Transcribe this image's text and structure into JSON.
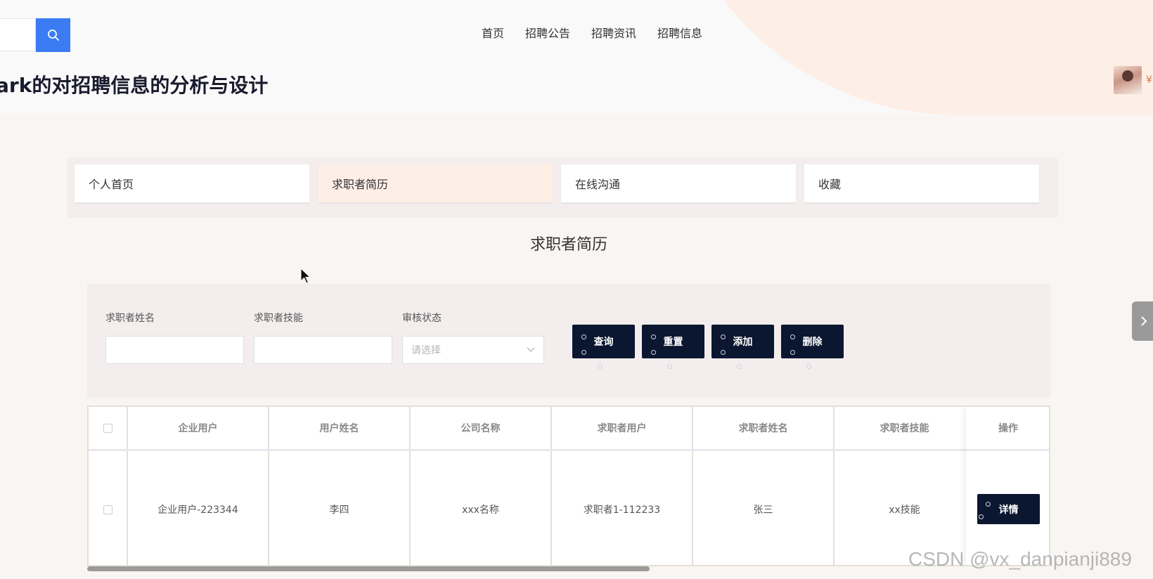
{
  "header": {
    "site_title": "ark的对招聘信息的分析与设计",
    "nav": [
      "首页",
      "招聘公告",
      "招聘资讯",
      "招聘信息"
    ],
    "search": {
      "value": "",
      "icon": "search-icon"
    },
    "avatar_name": "¥"
  },
  "tabs": [
    {
      "label": "个人首页",
      "active": false
    },
    {
      "label": "求职者简历",
      "active": true
    },
    {
      "label": "在线沟通",
      "active": false
    },
    {
      "label": "收藏",
      "active": false
    }
  ],
  "section_title": "求职者简历",
  "filters": {
    "name_label": "求职者姓名",
    "skill_label": "求职者技能",
    "status_label": "审核状态",
    "status_placeholder": "请选择",
    "buttons": [
      "查询",
      "重置",
      "添加",
      "删除"
    ]
  },
  "table": {
    "columns": [
      "企业用户",
      "用户姓名",
      "公司名称",
      "求职者用户",
      "求职者姓名",
      "求职者技能"
    ],
    "op_header": "操作",
    "rows": [
      [
        "企业用户-223344",
        "李四",
        "xxx名称",
        "求职者1-112233",
        "张三",
        "xx技能"
      ]
    ],
    "detail_label": "详情"
  },
  "watermark": "CSDN @vx_danpianji889",
  "colors": {
    "accent": "#3b7cf4",
    "dark_button": "#0b1630",
    "active_tab": "#fdeee6"
  }
}
